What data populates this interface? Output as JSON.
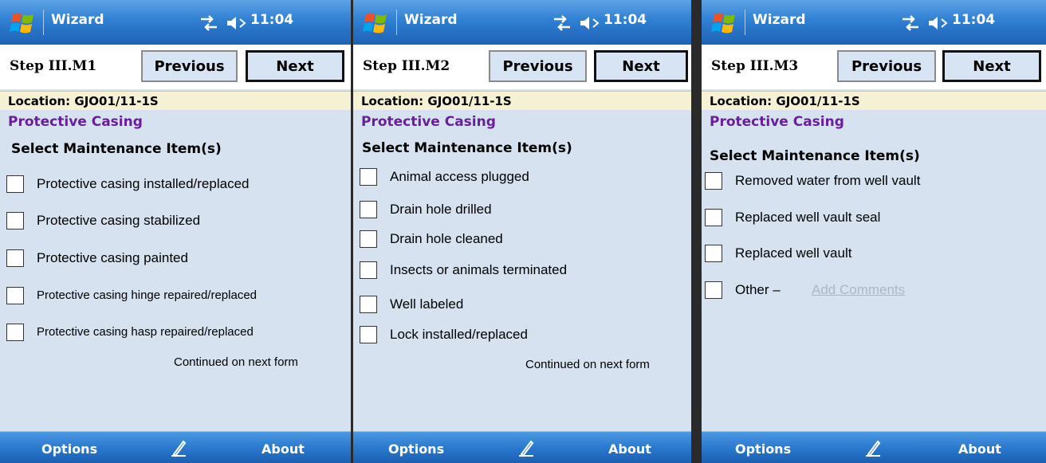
{
  "screens": [
    {
      "app_title": "Wizard",
      "time": "11:04",
      "step": "Step III.M1",
      "prev_label": "Previous",
      "next_label": "Next",
      "location": "Location: GJO01/11-1S",
      "section": "Protective Casing",
      "select_heading": "Select Maintenance Item(s)",
      "items": [
        "Protective casing installed/replaced",
        "Protective casing stabilized",
        "Protective casing painted",
        "Protective casing hinge repaired/replaced",
        "Protective casing hasp repaired/replaced"
      ],
      "continued": "Continued on next form",
      "softkey_left": "Options",
      "softkey_right": "About"
    },
    {
      "app_title": "Wizard",
      "time": "11:04",
      "step": "Step III.M2",
      "prev_label": "Previous",
      "next_label": "Next",
      "location": "Location: GJO01/11-1S",
      "section": "Protective Casing",
      "select_heading": "Select Maintenance Item(s)",
      "items": [
        "Animal access plugged",
        "Drain hole drilled",
        "Drain hole cleaned",
        "Insects or animals terminated",
        "Well labeled",
        "Lock installed/replaced"
      ],
      "continued": "Continued on next form",
      "softkey_left": "Options",
      "softkey_right": "About"
    },
    {
      "app_title": "Wizard",
      "time": "11:04",
      "step": "Step III.M3",
      "prev_label": "Previous",
      "next_label": "Next",
      "location": "Location: GJO01/11-1S",
      "section": "Protective Casing",
      "select_heading": "Select Maintenance Item(s)",
      "items": [
        "Removed water from well vault",
        "Replaced well vault seal",
        "Replaced well vault",
        "Other –"
      ],
      "add_comments": "Add Comments",
      "softkey_left": "Options",
      "softkey_right": "About"
    }
  ],
  "icons": {
    "start": "windows-flag-icon",
    "connectivity": "connectivity-arrows-icon",
    "volume": "speaker-off-icon",
    "input": "pen-input-icon"
  },
  "colors": {
    "titlebar": "#2f7fd3",
    "body_bg": "#d6e2f0",
    "location_bg": "#f6f1d3",
    "section_text": "#6a1f9a",
    "add_comments_text": "#a9b7c8"
  }
}
